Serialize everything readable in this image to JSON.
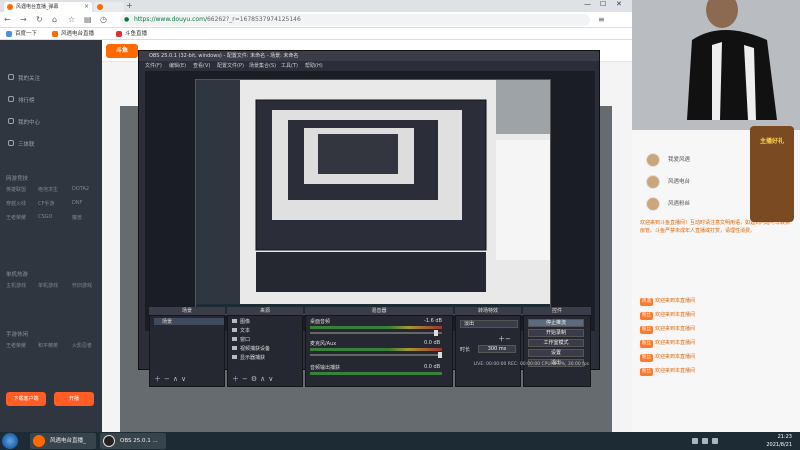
{
  "browser": {
    "tabs": [
      {
        "label": "风遇电台直播_弹幕"
      },
      {
        "label": "斗鱼直播"
      }
    ],
    "url_host": "https://www.douyu.com/",
    "url_path": "66262?_r=1678537974125146",
    "bookmarks": [
      "百度一下",
      "风遇电台直播",
      "斗鱼直播"
    ]
  },
  "douyu": {
    "logo": "斗鱼",
    "sidebar_items": [
      "我的关注",
      "排行榜",
      "我的中心",
      "三体联"
    ],
    "sidebar_sections": [
      {
        "title": "网游竞技",
        "items": [
          "英雄联盟",
          "绝地求生",
          "DOTA2",
          "穿越火线",
          "CF手游",
          "DNF",
          "王者荣耀",
          "CSGO",
          "魔兽"
        ]
      },
      {
        "title": "单机热游",
        "items": [
          "主机游戏",
          "单机游戏",
          "怀旧游戏"
        ]
      },
      {
        "title": "手游休闲",
        "items": [
          "王者荣耀",
          "和平精英",
          "火影忍者"
        ]
      }
    ],
    "sidebar_buttons": [
      "下载客户端",
      "开播"
    ]
  },
  "obs": {
    "title": "OBS 25.0.1 (32-bit, windows) - 配置文件: 未命名 - 场景: 未命名",
    "menu": [
      "文件(F)",
      "编辑(E)",
      "查看(V)",
      "配置文件(P)",
      "场景集合(S)",
      "工具(T)",
      "帮助(H)"
    ],
    "docks": {
      "scenes": "场景",
      "sources": "来源",
      "mixer": "混音器",
      "transitions": "转场特效",
      "controls": "控件"
    },
    "scene_items": [
      "场景"
    ],
    "source_items": [
      "图像",
      "文本",
      "窗口",
      "视频捕获设备",
      "显示器捕获"
    ],
    "mixer_tracks": [
      {
        "label": "桌面音频",
        "db": "-1.6 dB"
      },
      {
        "label": "麦克风/Aux",
        "db": "0.0 dB"
      },
      {
        "label": "音频输出捕获",
        "db": "0.0 dB"
      }
    ],
    "transition": {
      "type": "淡出",
      "duration_label": "时长",
      "duration_value": "300 ms"
    },
    "control_buttons": [
      "停止推流",
      "开始录制",
      "工作室模式",
      "设置",
      "退出"
    ],
    "status": "LIVE: 00:00:00    REC: 00:00:00    CPU: 9.0%, 30.00 fps"
  },
  "chat": {
    "rank_users": [
      "我爱风遇",
      "风遇电台",
      "风遇粉丝"
    ],
    "notice": "欢迎来到斗鱼直播间！互动时请注意文明用语，如遇到问题可以联系房管。斗鱼严禁未成年人直播或打赏，请理性消费。",
    "messages": [
      {
        "badge": "风遇",
        "name": "欢迎来到本直播间",
        "text": ""
      },
      {
        "badge": "粉丝",
        "name": "欢迎来到本直播间",
        "text": ""
      },
      {
        "badge": "粉丝",
        "name": "欢迎来到本直播间",
        "text": ""
      },
      {
        "badge": "粉丝",
        "name": "欢迎来到本直播间",
        "text": ""
      },
      {
        "badge": "粉丝",
        "name": "欢迎来到本直播间",
        "text": ""
      },
      {
        "badge": "粉丝",
        "name": "欢迎来到本直播间",
        "text": ""
      }
    ],
    "badge_title": "主播好礼"
  },
  "taskbar": {
    "apps": [
      "风遇电台直播_弹...",
      "OBS 25.0.1 ..."
    ],
    "time": "21:23",
    "date": "2021/8/21"
  },
  "colors": {
    "accent": "#ff6a00",
    "obs_bg": "#2b2e38",
    "taskbar": "#1d2b34"
  }
}
